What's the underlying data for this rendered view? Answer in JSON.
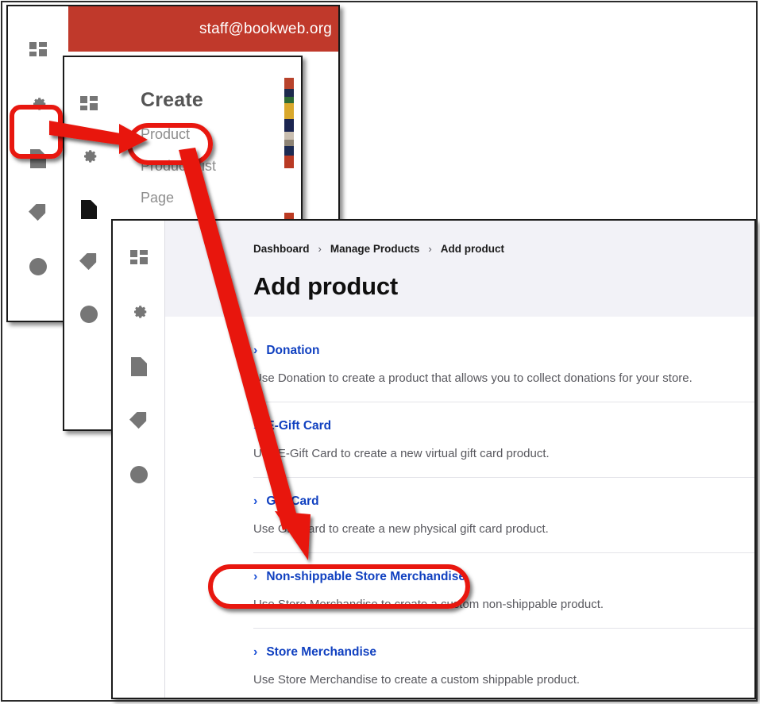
{
  "window_back": {
    "name": "staff-account-window",
    "header_email": "staff@bookweb.org",
    "rail_icons": [
      {
        "name": "dashboard-icon",
        "glyph": "dashboard"
      },
      {
        "name": "gear-icon",
        "glyph": "gear"
      },
      {
        "name": "page-icon",
        "glyph": "page"
      },
      {
        "name": "tag-icon",
        "glyph": "tag"
      },
      {
        "name": "dollar-icon",
        "glyph": "dollar"
      }
    ]
  },
  "window_create": {
    "title": "Create",
    "menu_items": [
      {
        "label": "Product"
      },
      {
        "label": "Product List"
      },
      {
        "label": "Page"
      }
    ],
    "rail_icons": [
      {
        "name": "dashboard-icon",
        "glyph": "dashboard",
        "active": false
      },
      {
        "name": "gear-icon",
        "glyph": "gear",
        "active": false
      },
      {
        "name": "page-icon",
        "glyph": "page",
        "active": true
      },
      {
        "name": "tag-icon",
        "glyph": "tag",
        "active": false
      },
      {
        "name": "dollar-icon",
        "glyph": "dollar",
        "active": false
      }
    ]
  },
  "window_main": {
    "breadcrumb": [
      {
        "label": "Dashboard"
      },
      {
        "label": "Manage Products"
      },
      {
        "label": "Add product"
      }
    ],
    "breadcrumb_separator": "›",
    "page_title": "Add product",
    "rail_icons": [
      {
        "name": "dashboard-icon",
        "glyph": "dashboard"
      },
      {
        "name": "gear-icon",
        "glyph": "gear"
      },
      {
        "name": "page-icon",
        "glyph": "page"
      },
      {
        "name": "tag-icon",
        "glyph": "tag"
      },
      {
        "name": "dollar-icon",
        "glyph": "dollar"
      }
    ],
    "chevron": "›",
    "product_types": [
      {
        "name": "Donation",
        "description": "Use Donation to create a product that allows you to collect donations for your store."
      },
      {
        "name": "E-Gift Card",
        "description": "Use E-Gift Card to create a new virtual gift card product."
      },
      {
        "name": "Gift Card",
        "description": "Use Gift Card to create a new physical gift card product."
      },
      {
        "name": "Non-shippable Store Merchandise",
        "description": "Use Store Merchandise to create a custom non-shippable product."
      },
      {
        "name": "Store Merchandise",
        "description": "Use Store Merchandise to create a custom shippable product."
      }
    ]
  },
  "annotations": {
    "highlight_page_icon": {
      "name": "highlight-page-icon"
    },
    "highlight_product_item": {
      "name": "highlight-product-menu-item"
    },
    "highlight_non_shippable": {
      "name": "highlight-non-shippable-row"
    },
    "arrow_short": {
      "name": "arrow-rail-to-product"
    },
    "arrow_long": {
      "name": "arrow-product-to-non-shippable"
    },
    "color": "#e8170f"
  },
  "colors": {
    "accent_red": "#c0392b",
    "annotation_red": "#e8170f",
    "link_blue": "#1040c0",
    "header_bg": "#f2f2f7",
    "icon_grey": "#767676"
  }
}
